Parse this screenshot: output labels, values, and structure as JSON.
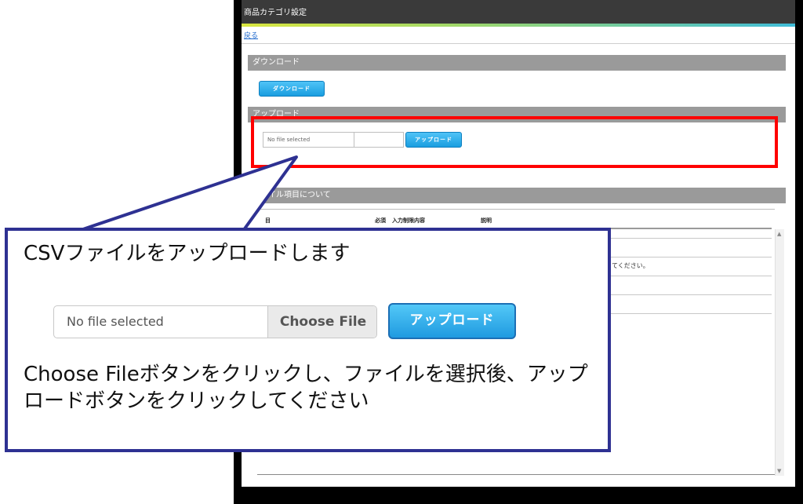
{
  "window": {
    "title": "商品カテゴリ設定",
    "back_link": "戻る"
  },
  "download_section": {
    "header": "ダウンロード",
    "button_label": "ダウンロード"
  },
  "upload_section": {
    "header": "アップロード",
    "file_placeholder": "No file selected",
    "button_label": "アップロード"
  },
  "csv_section": {
    "header": "ファイル項目について",
    "columns": [
      "目",
      "必須",
      "入力制限内容",
      "説明"
    ],
    "partial_description": "てください。"
  },
  "callout": {
    "title": "CSVファイルをアップロードします",
    "file_placeholder": "No file selected",
    "choose_file_label": "Choose File",
    "upload_label": "アップロード",
    "body": "Choose Fileボタンをクリックし、ファイルを選択後、アップロードボタンをクリックしてください"
  },
  "colors": {
    "highlight": "#ff0000",
    "callout_border": "#2e3192",
    "button_blue": "#1a9ee0",
    "section_gray": "#9a9a9a"
  }
}
